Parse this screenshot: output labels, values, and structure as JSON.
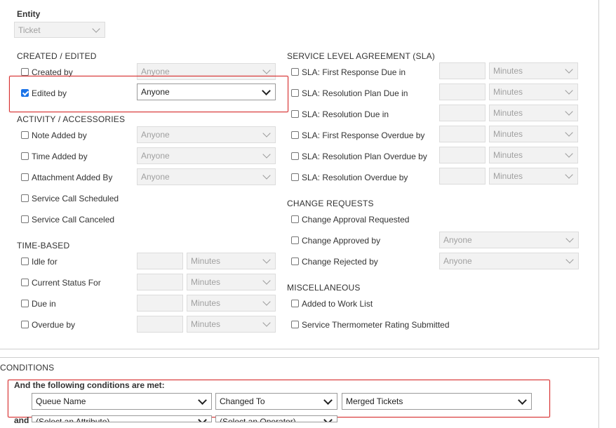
{
  "entity": {
    "label": "Entity",
    "value": "Ticket"
  },
  "created_edited": {
    "title": "CREATED / EDITED",
    "items": [
      {
        "label": "Created by",
        "value": "Anyone",
        "checked": false
      },
      {
        "label": "Edited by",
        "value": "Anyone",
        "checked": true
      }
    ]
  },
  "activity": {
    "title": "ACTIVITY / ACCESSORIES",
    "items": [
      {
        "label": "Note Added by",
        "value": "Anyone"
      },
      {
        "label": "Time Added by",
        "value": "Anyone"
      },
      {
        "label": "Attachment Added By",
        "value": "Anyone"
      },
      {
        "label": "Service Call Scheduled"
      },
      {
        "label": "Service Call Canceled"
      }
    ]
  },
  "time_based": {
    "title": "TIME-BASED",
    "items": [
      {
        "label": "Idle for",
        "unit": "Minutes"
      },
      {
        "label": "Current Status For",
        "unit": "Minutes"
      },
      {
        "label": "Due in",
        "unit": "Minutes"
      },
      {
        "label": "Overdue by",
        "unit": "Minutes"
      }
    ]
  },
  "sla": {
    "title": "SERVICE LEVEL AGREEMENT (SLA)",
    "items": [
      {
        "label": "SLA: First Response Due in",
        "unit": "Minutes"
      },
      {
        "label": "SLA: Resolution Plan Due in",
        "unit": "Minutes"
      },
      {
        "label": "SLA: Resolution Due in",
        "unit": "Minutes"
      },
      {
        "label": "SLA: First Response Overdue by",
        "unit": "Minutes"
      },
      {
        "label": "SLA: Resolution Plan Overdue by",
        "unit": "Minutes"
      },
      {
        "label": "SLA: Resolution Overdue by",
        "unit": "Minutes"
      }
    ]
  },
  "change_requests": {
    "title": "CHANGE REQUESTS",
    "items": [
      {
        "label": "Change Approval Requested"
      },
      {
        "label": "Change Approved by",
        "value": "Anyone"
      },
      {
        "label": "Change Rejected by",
        "value": "Anyone"
      }
    ]
  },
  "misc": {
    "title": "MISCELLANEOUS",
    "items": [
      {
        "label": "Added to Work List"
      },
      {
        "label": "Service Thermometer Rating Submitted"
      }
    ]
  },
  "conditions": {
    "title": "CONDITIONS",
    "subtitle": "And the following conditions are met:",
    "row1": {
      "attribute": "Queue Name",
      "operator": "Changed To",
      "value": "Merged Tickets"
    },
    "row2": {
      "conj": "and",
      "attribute": "(Select an Attribute)",
      "operator": "(Select an Operator)"
    }
  },
  "colors": {
    "highlight": "#d62d2d",
    "checkbox": "#1a73e8"
  }
}
